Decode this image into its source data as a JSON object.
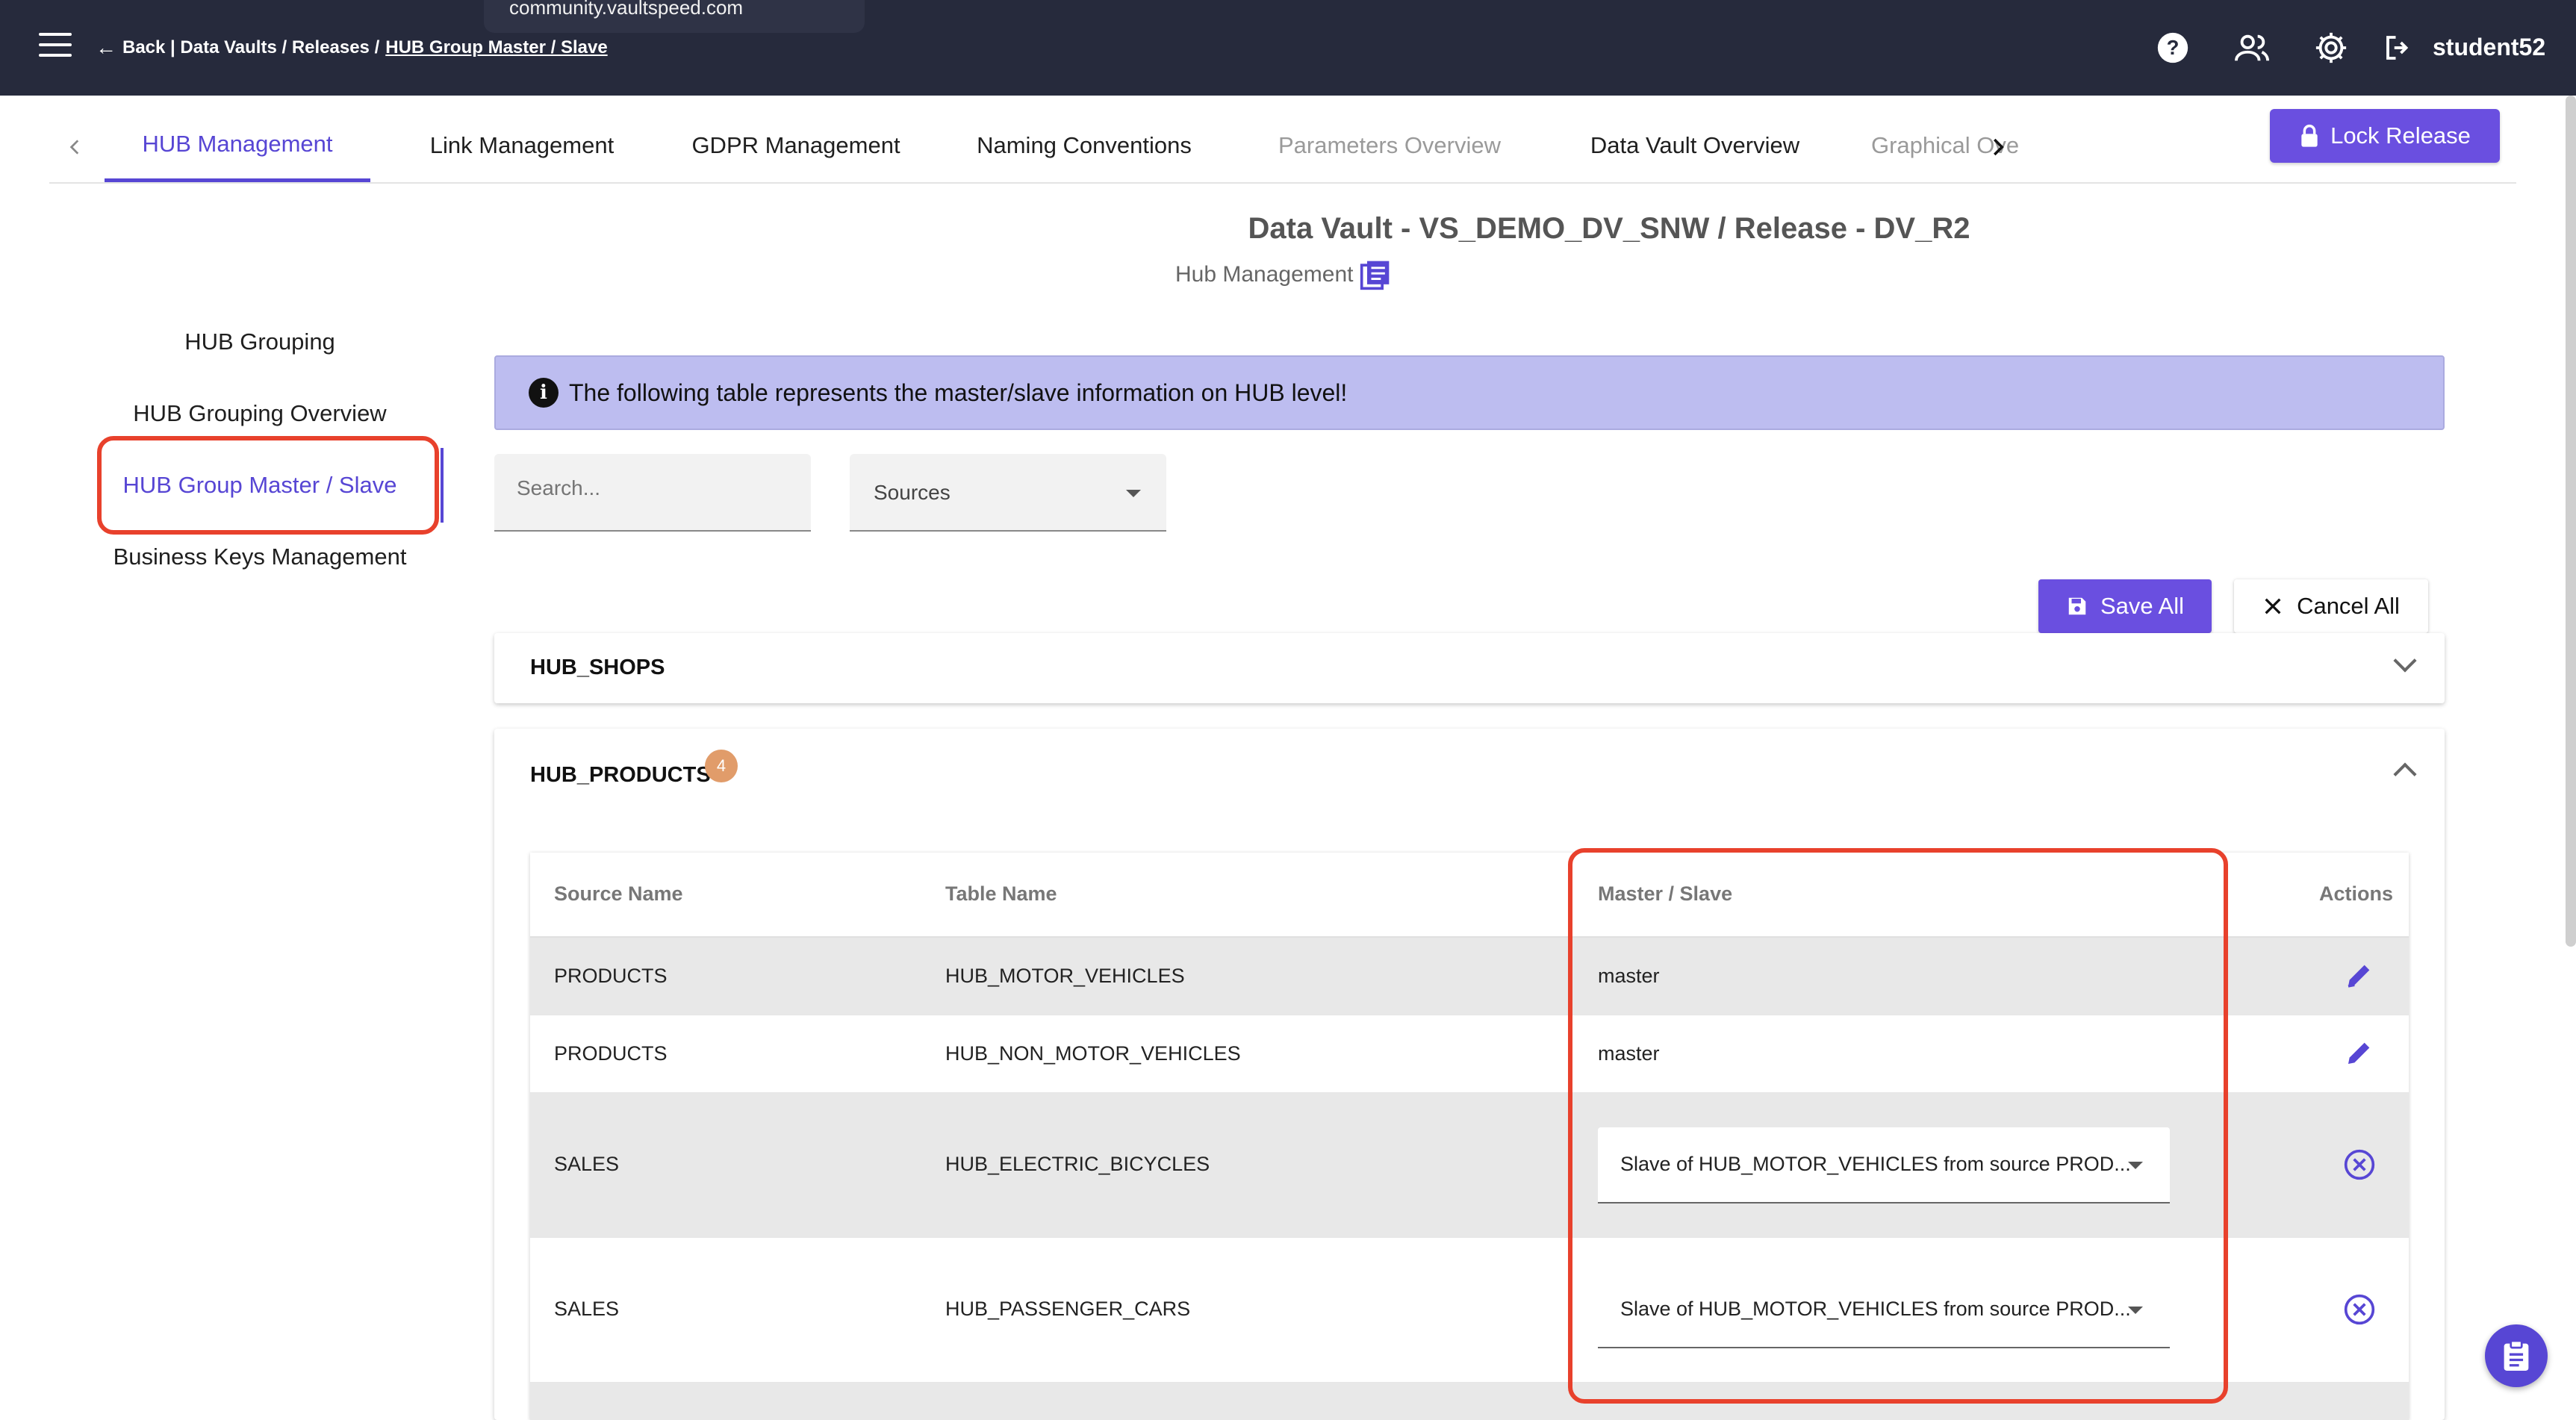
{
  "tooltip": {
    "url": "community.vaultspeed.com"
  },
  "header": {
    "back_prefix": "Back | Data Vaults / Releases / ",
    "current": "HUB Group Master / Slave",
    "username": "student52",
    "icons": [
      "help-icon",
      "users-icon",
      "settings-icon",
      "logout-icon"
    ]
  },
  "tabs": [
    {
      "label": "HUB Management",
      "state": "active"
    },
    {
      "label": "Link Management",
      "state": "normal"
    },
    {
      "label": "GDPR Management",
      "state": "normal"
    },
    {
      "label": "Naming Conventions",
      "state": "normal"
    },
    {
      "label": "Parameters Overview",
      "state": "disabled"
    },
    {
      "label": "Data Vault Overview",
      "state": "normal"
    },
    {
      "label": "Graphical Ove",
      "state": "disabled"
    }
  ],
  "lock_button": {
    "label": "Lock Release"
  },
  "page": {
    "title": "Data Vault - VS_DEMO_DV_SNW / Release - DV_R2",
    "subtitle": "Hub Management"
  },
  "side_nav": [
    {
      "label": "HUB Grouping"
    },
    {
      "label": "HUB Grouping Overview"
    },
    {
      "label": "HUB Group Master / Slave",
      "active": true
    },
    {
      "label": "Business Keys Management"
    }
  ],
  "info_banner": {
    "text": "The following table represents the master/slave information on HUB level!"
  },
  "filters": {
    "search_placeholder": "Search...",
    "sources_label": "Sources"
  },
  "actions": {
    "save_all": "Save All",
    "cancel_all": "Cancel All"
  },
  "panels": [
    {
      "title": "HUB_SHOPS",
      "expanded": false
    },
    {
      "title": "HUB_PRODUCTS",
      "expanded": true,
      "badge": "4"
    }
  ],
  "table": {
    "headers": {
      "source": "Source Name",
      "table": "Table Name",
      "ms": "Master / Slave",
      "actions": "Actions"
    },
    "rows": [
      {
        "source": "PRODUCTS",
        "table": "HUB_MOTOR_VEHICLES",
        "ms": "master",
        "action": "edit-icon"
      },
      {
        "source": "PRODUCTS",
        "table": "HUB_NON_MOTOR_VEHICLES",
        "ms": "master",
        "action": "edit-icon"
      },
      {
        "source": "SALES",
        "table": "HUB_ELECTRIC_BICYCLES",
        "ms": "Slave of HUB_MOTOR_VEHICLES from source PROD...",
        "action": "cancel-circle-icon"
      },
      {
        "source": "SALES",
        "table": "HUB_PASSENGER_CARS",
        "ms": "Slave of HUB_MOTOR_VEHICLES from source PROD...",
        "action": "cancel-circle-icon"
      }
    ]
  },
  "colors": {
    "accent": "#5746d4",
    "button": "#6a4fe0",
    "topbar": "#262a3c",
    "highlight": "#e8412c",
    "banner": "#bdbdf0",
    "badge": "#e19c6a"
  }
}
